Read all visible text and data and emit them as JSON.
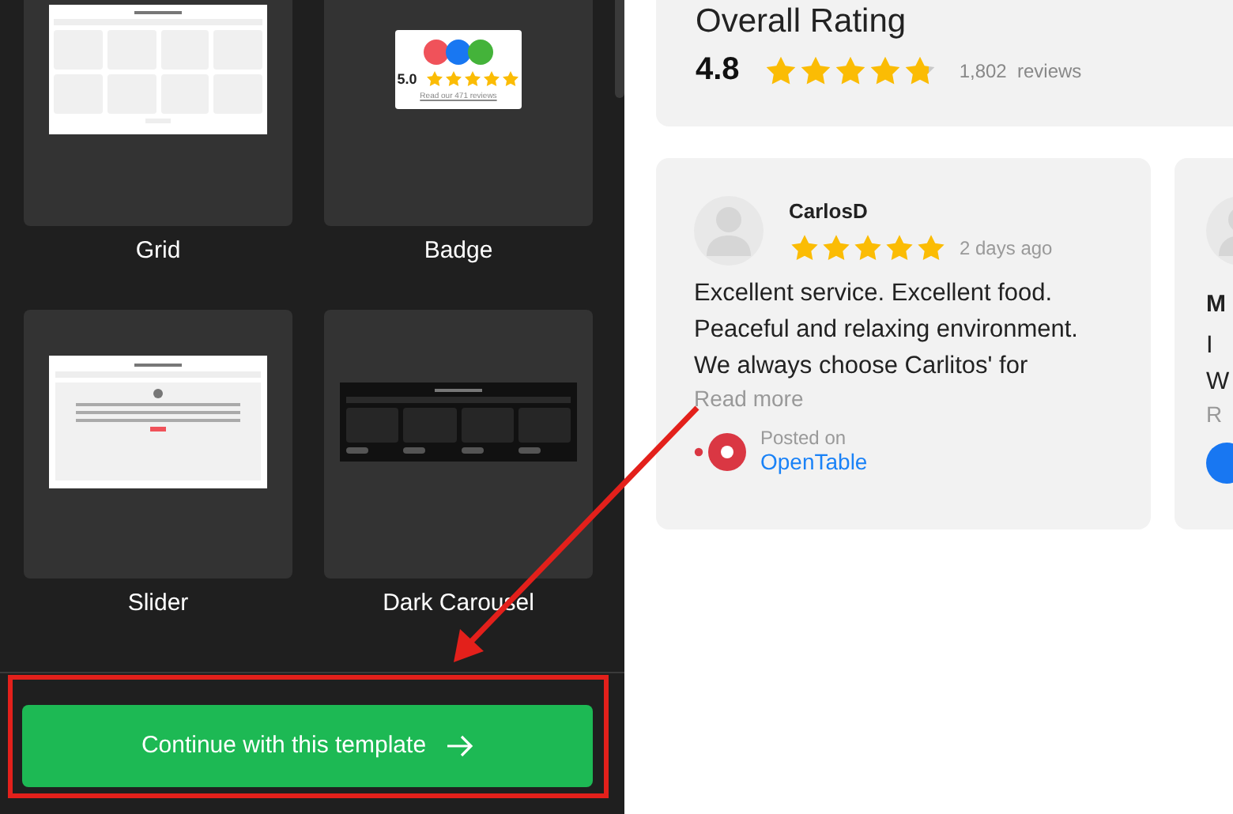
{
  "templates": [
    {
      "label": "Grid",
      "kind": "grid"
    },
    {
      "label": "Badge",
      "kind": "badge",
      "rating": "5.0",
      "stars": 5,
      "link": "Read our 471 reviews"
    },
    {
      "label": "Slider",
      "kind": "slider"
    },
    {
      "label": "Dark Carousel",
      "kind": "dark"
    }
  ],
  "footer": {
    "button": "Continue with this template"
  },
  "overall": {
    "title": "Overall Rating",
    "score": "4.8",
    "stars": 4.8,
    "count": "1,802  reviews"
  },
  "reviews": [
    {
      "name": "CarlosD",
      "stars": 5,
      "time": "2 days ago",
      "lines": [
        "Excellent service. Excellent food.",
        "Peaceful and relaxing environment.",
        "We always choose Carlitos' for"
      ],
      "read_more": "Read more",
      "posted_label": "Posted on",
      "source": "OpenTable",
      "logo": {
        "kind": "opentable"
      }
    },
    {
      "name": "M",
      "lines": [
        "I",
        "W"
      ],
      "read_more": "R",
      "logo": {
        "kind": "blue"
      }
    }
  ]
}
